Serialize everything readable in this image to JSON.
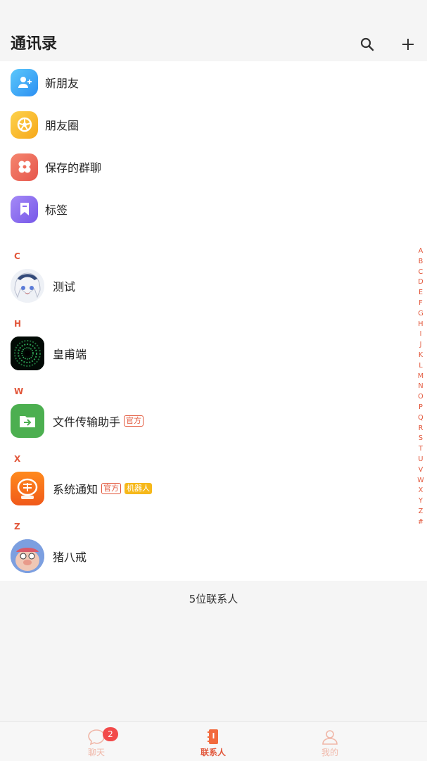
{
  "header": {
    "title": "通讯录",
    "search_icon": "search-icon",
    "add_icon": "plus-icon"
  },
  "features": [
    {
      "label": "新朋友",
      "icon": "add-friend-icon",
      "color": "#3aa8f5"
    },
    {
      "label": "朋友圈",
      "icon": "moments-icon",
      "color": "#f9b31b"
    },
    {
      "label": "保存的群聊",
      "icon": "group-chat-icon",
      "color": "#ef6f5c"
    },
    {
      "label": "标签",
      "icon": "tag-icon",
      "color": "#8c6df2"
    }
  ],
  "sections": [
    {
      "letter": "C",
      "contacts": [
        {
          "name": "测试",
          "tags": []
        }
      ]
    },
    {
      "letter": "H",
      "contacts": [
        {
          "name": "皇甫端",
          "tags": []
        }
      ]
    },
    {
      "letter": "W",
      "contacts": [
        {
          "name": "文件传输助手",
          "tags": [
            "官方"
          ]
        }
      ]
    },
    {
      "letter": "X",
      "contacts": [
        {
          "name": "系统通知",
          "tags": [
            "官方",
            "机器人"
          ]
        }
      ]
    },
    {
      "letter": "Z",
      "contacts": [
        {
          "name": "猪八戒",
          "tags": []
        }
      ]
    }
  ],
  "alphabet": [
    "A",
    "B",
    "C",
    "D",
    "E",
    "F",
    "G",
    "H",
    "I",
    "J",
    "K",
    "L",
    "M",
    "N",
    "O",
    "P",
    "Q",
    "R",
    "S",
    "T",
    "U",
    "V",
    "W",
    "X",
    "Y",
    "Z",
    "#"
  ],
  "footer_count": "5位联系人",
  "tabs": [
    {
      "label": "聊天",
      "icon": "chat-icon",
      "badge": "2"
    },
    {
      "label": "联系人",
      "icon": "contacts-icon"
    },
    {
      "label": "我的",
      "icon": "profile-icon"
    }
  ],
  "colors": {
    "accent": "#e2573b",
    "badge": "#f24a4a",
    "robot_tag": "#f6b81a",
    "tab_inactive": "#f0b7a8"
  }
}
